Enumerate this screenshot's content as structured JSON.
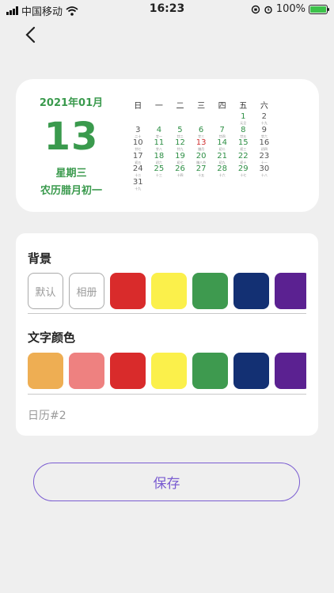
{
  "status": {
    "carrier": "中国移动",
    "time": "16:23",
    "battery": "100%",
    "battery_level": 1.0
  },
  "nav": {
    "back_icon": "chevron-left-icon"
  },
  "calendar": {
    "year_month": "2021年01月",
    "day": "13",
    "weekday": "星期三",
    "lunar": "农历腊月初一",
    "weekdays": [
      "日",
      "一",
      "二",
      "三",
      "四",
      "五",
      "六"
    ],
    "cells": [
      {
        "n": "",
        "l": "",
        "c": "k"
      },
      {
        "n": "",
        "l": "",
        "c": "k"
      },
      {
        "n": "",
        "l": "",
        "c": "k"
      },
      {
        "n": "",
        "l": "",
        "c": "k"
      },
      {
        "n": "",
        "l": "",
        "c": "k"
      },
      {
        "n": "1",
        "l": "元旦",
        "c": "g"
      },
      {
        "n": "2",
        "l": "十九",
        "c": "k"
      },
      {
        "n": "3",
        "l": "二十",
        "c": "k"
      },
      {
        "n": "4",
        "l": "廿一",
        "c": "g"
      },
      {
        "n": "5",
        "l": "廿二",
        "c": "g"
      },
      {
        "n": "6",
        "l": "廿三",
        "c": "g"
      },
      {
        "n": "7",
        "l": "廿四",
        "c": "g"
      },
      {
        "n": "8",
        "l": "廿五",
        "c": "g"
      },
      {
        "n": "9",
        "l": "廿六",
        "c": "k"
      },
      {
        "n": "10",
        "l": "廿七",
        "c": "k"
      },
      {
        "n": "11",
        "l": "廿八",
        "c": "g"
      },
      {
        "n": "12",
        "l": "廿九",
        "c": "g"
      },
      {
        "n": "13",
        "l": "腊月",
        "c": "r"
      },
      {
        "n": "14",
        "l": "初二",
        "c": "g"
      },
      {
        "n": "15",
        "l": "初三",
        "c": "g"
      },
      {
        "n": "16",
        "l": "初四",
        "c": "k"
      },
      {
        "n": "17",
        "l": "初五",
        "c": "k"
      },
      {
        "n": "18",
        "l": "初六",
        "c": "g"
      },
      {
        "n": "19",
        "l": "初七",
        "c": "g"
      },
      {
        "n": "20",
        "l": "腊八节",
        "c": "g"
      },
      {
        "n": "21",
        "l": "初九",
        "c": "g"
      },
      {
        "n": "22",
        "l": "初十",
        "c": "g"
      },
      {
        "n": "23",
        "l": "十一",
        "c": "k"
      },
      {
        "n": "24",
        "l": "十二",
        "c": "k"
      },
      {
        "n": "25",
        "l": "十三",
        "c": "g"
      },
      {
        "n": "26",
        "l": "十四",
        "c": "g"
      },
      {
        "n": "27",
        "l": "十五",
        "c": "g"
      },
      {
        "n": "28",
        "l": "十六",
        "c": "g"
      },
      {
        "n": "29",
        "l": "十七",
        "c": "g"
      },
      {
        "n": "30",
        "l": "十八",
        "c": "k"
      },
      {
        "n": "31",
        "l": "十九",
        "c": "k"
      }
    ]
  },
  "background": {
    "title": "背景",
    "default_label": "默认",
    "album_label": "相册",
    "swatches": [
      "#d92b2b",
      "#fbf04b",
      "#3e9a4f",
      "#133073",
      "#5b2191"
    ]
  },
  "text_color": {
    "title": "文字颜色",
    "swatches": [
      "#eeae53",
      "#ee8180",
      "#d92b2b",
      "#fbf04b",
      "#3e9a4f",
      "#133073",
      "#5b2191"
    ]
  },
  "calendar_name": "日历#2",
  "save_label": "保存"
}
